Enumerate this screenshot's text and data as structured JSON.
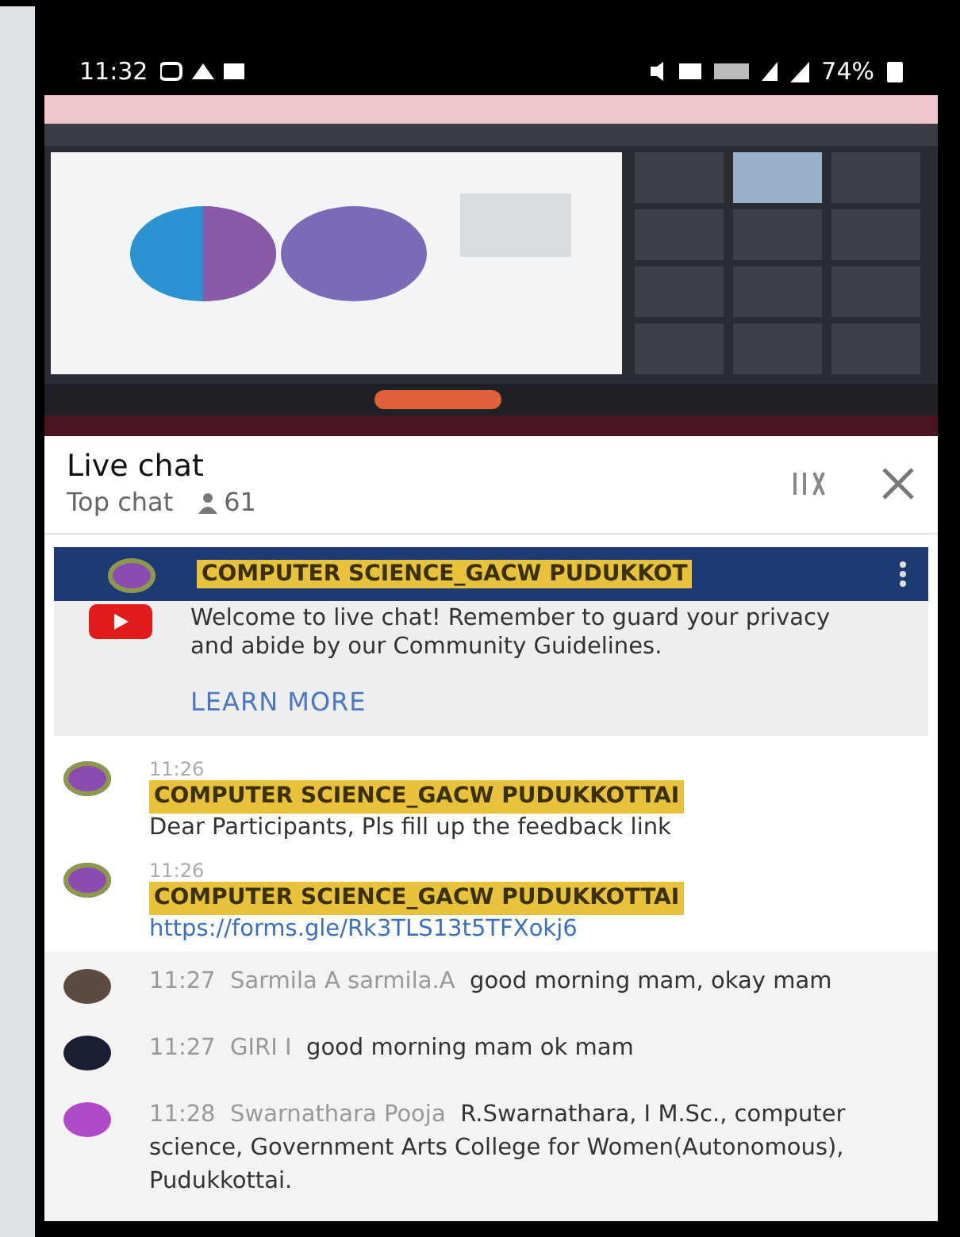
{
  "status_bar": {
    "time": "11:32",
    "battery": "74%"
  },
  "live_chat": {
    "title": "Live chat",
    "mode": "Top chat",
    "viewers": "61"
  },
  "pinned": {
    "author": "COMPUTER SCIENCE_GACW PUDUKKOT",
    "welcome": "Welcome to live chat! Remember to guard your privacy and abide by our Community Guidelines.",
    "link": "LEARN MORE"
  },
  "messages": [
    {
      "kind": "owner",
      "time": "11:26",
      "author": "COMPUTER SCIENCE_GACW PUDUKKOTTAI",
      "text": "Dear Participants, Pls fill up the feedback link",
      "link": false,
      "color": "#8c4bb0"
    },
    {
      "kind": "owner",
      "time": "11:26",
      "author": "COMPUTER SCIENCE_GACW PUDUKKOTTAI",
      "text": "https://forms.gle/Rk3TLS13t5TFXokj6",
      "link": true,
      "color": "#8c4bb0"
    },
    {
      "kind": "viewer",
      "time": "11:27",
      "author": "Sarmila A sarmila.A",
      "text": "good morning mam, okay mam",
      "link": false,
      "color": "#5a4a40"
    },
    {
      "kind": "viewer",
      "time": "11:27",
      "author": "GIRI I",
      "text": "good morning mam ok mam",
      "link": false,
      "color": "#1a1f33"
    },
    {
      "kind": "viewer",
      "time": "11:28",
      "author": "Swarnathara Pooja",
      "text": "R.Swarnathara, I M.Sc., computer science, Government Arts College for Women(Autonomous), Pudukkottai.",
      "link": false,
      "color": "#b04ac8"
    }
  ]
}
